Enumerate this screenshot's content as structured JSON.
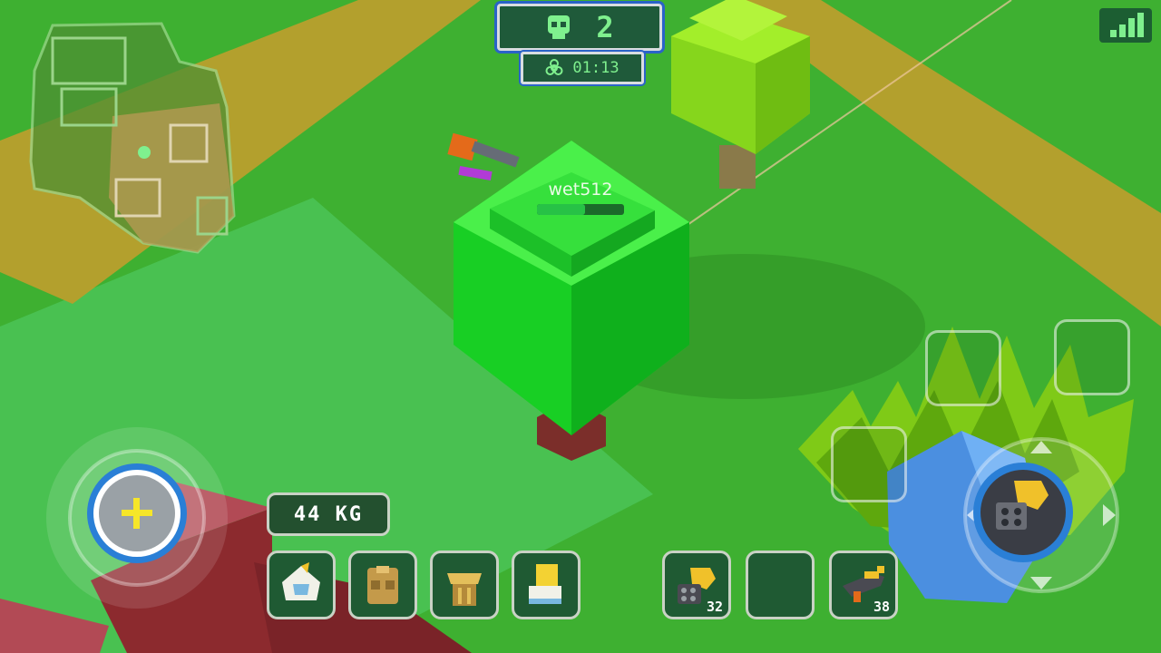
{
  "hud": {
    "kills": "2",
    "kills_icon": "skull-icon",
    "timer": "01:13",
    "timer_icon": "biohazard-icon",
    "signal_icon": "signal-bars-icon"
  },
  "player": {
    "name": "wet512",
    "health_fraction": 0.55
  },
  "inventory": {
    "weight": "44 KG",
    "armor_slots": [
      {
        "icon": "helmet-icon"
      },
      {
        "icon": "vest-icon"
      },
      {
        "icon": "backpack-icon"
      },
      {
        "icon": "boots-icon"
      }
    ],
    "weapon_slots": [
      {
        "icon": "minigun-icon",
        "count": "32"
      },
      {
        "icon": "empty-slot",
        "count": ""
      },
      {
        "icon": "rifle-icon",
        "count": "38"
      }
    ]
  },
  "controls": {
    "joystick_icon": "plus-icon",
    "fire_icon": "minigun-icon",
    "direction_icons": [
      "arrow-up-icon",
      "arrow-down-icon",
      "arrow-left-icon",
      "arrow-right-icon"
    ]
  },
  "colors": {
    "ground": "#3eb031",
    "path": "#b3a02d",
    "hud_text": "#7ff08e",
    "hud_border": "#2a63c8"
  }
}
